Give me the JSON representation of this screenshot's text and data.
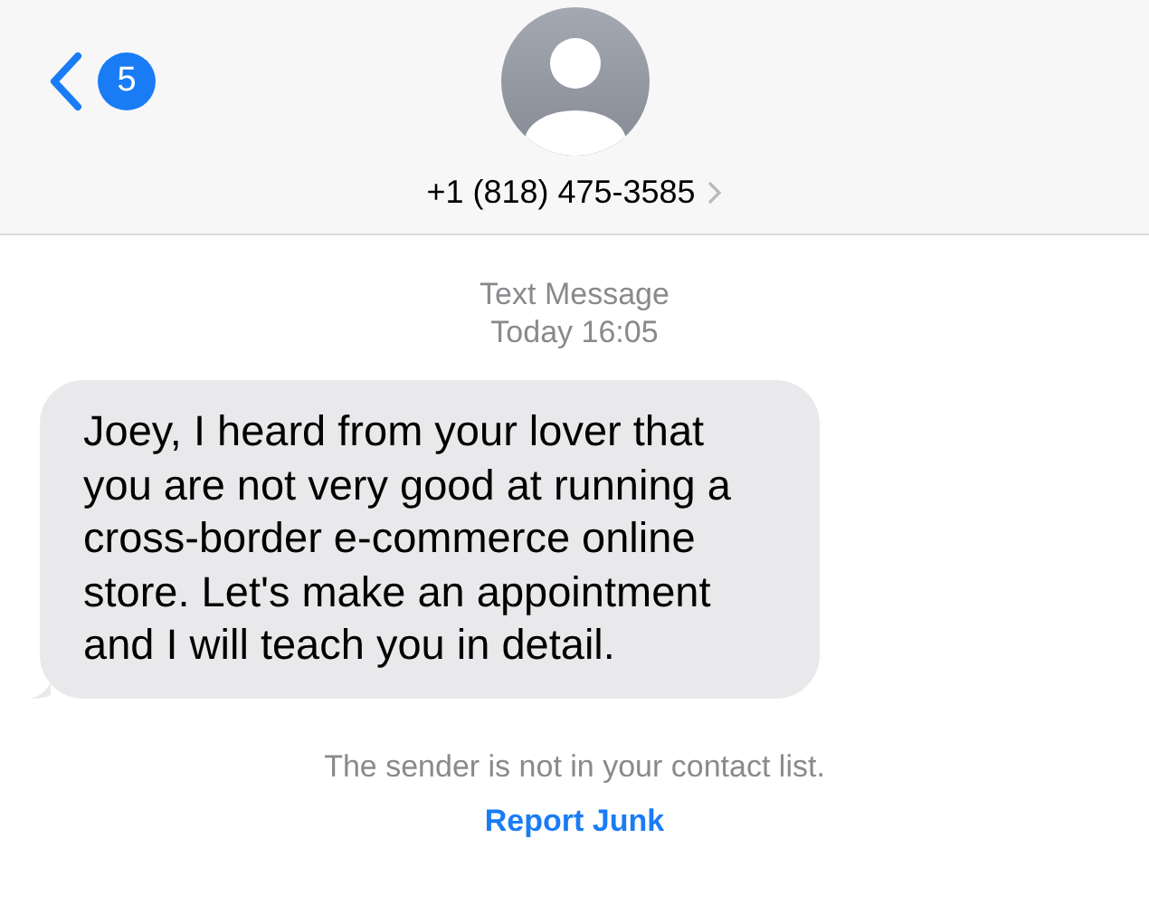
{
  "header": {
    "unread_count": "5",
    "contact": "+1 (818) 475-3585"
  },
  "conversation": {
    "service": "Text Message",
    "timestamp": "Today 16:05"
  },
  "messages": [
    {
      "text": "Joey, I heard from your lover that you are not very good at running a cross-border e-commerce online store. Let's make an appointment and I will teach you in detail."
    }
  ],
  "notice": {
    "text": "The sender is not in your contact list.",
    "action": "Report Junk"
  }
}
